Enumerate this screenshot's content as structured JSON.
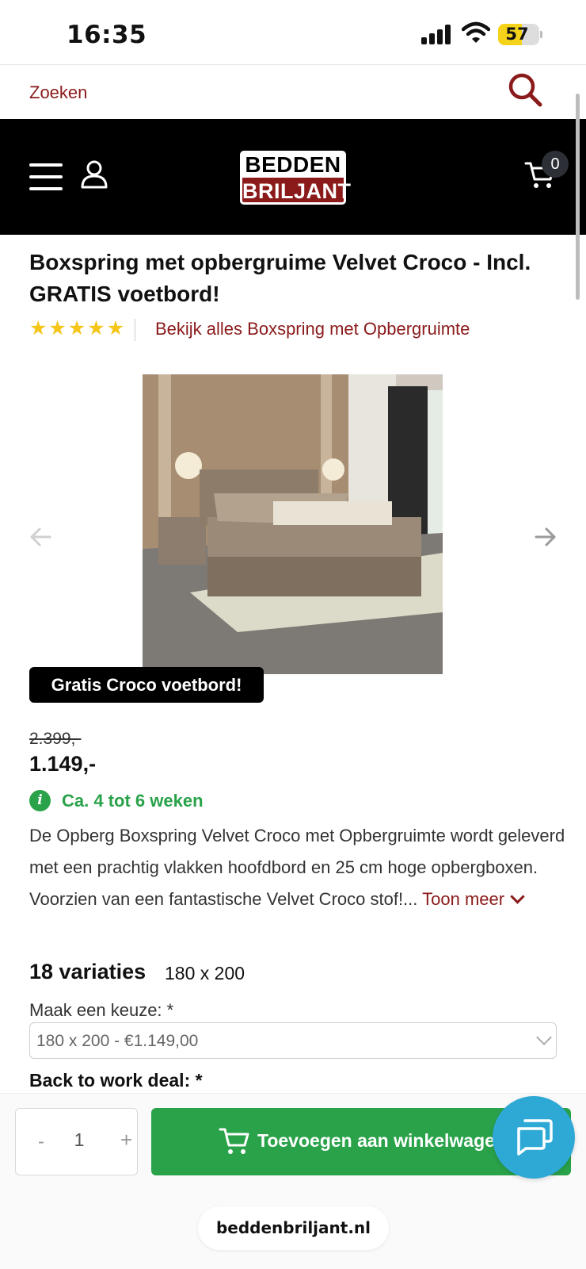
{
  "status_bar": {
    "time": "16:35",
    "battery": "57"
  },
  "search": {
    "placeholder": "Zoeken"
  },
  "header": {
    "logo_top": "BEDDEN",
    "logo_bottom": "BRILJANT",
    "cart_count": "0"
  },
  "product": {
    "title": "Boxspring met opbergruime Velvet Croco - Incl. GRATIS voetbord!",
    "rating_stars": 5,
    "category_link": "Bekijk alles Boxspring met Opbergruimte",
    "promo_badge": "Gratis Croco voetbord!",
    "old_price": "2.399,-",
    "price": "1.149,-",
    "delivery": "Ca. 4 tot 6 weken",
    "description": "De Opberg Boxspring Velvet Croco met Opbergruimte wordt geleverd met een prachtig vlakken hoofdbord en 25 cm hoge opbergboxen. Voorzien van een fantastische Velvet Croco stof!...",
    "show_more": "Toon meer",
    "variations_title": "18 variaties",
    "variation_value": "180 x 200",
    "choose_label": "Maak een keuze:  *",
    "selected_option": "180 x 200 - €1.149,00",
    "deal_label": "Back to work deal:  *"
  },
  "cart_bar": {
    "minus": "-",
    "quantity": "1",
    "plus": "+",
    "add_to_cart": "Toevoegen aan winkelwagen"
  },
  "browser": {
    "url": "beddenbriljant.nl"
  },
  "colors": {
    "brand_red": "#8b1a1a",
    "green": "#2aa24a",
    "chat_blue": "#2ea9d6"
  }
}
